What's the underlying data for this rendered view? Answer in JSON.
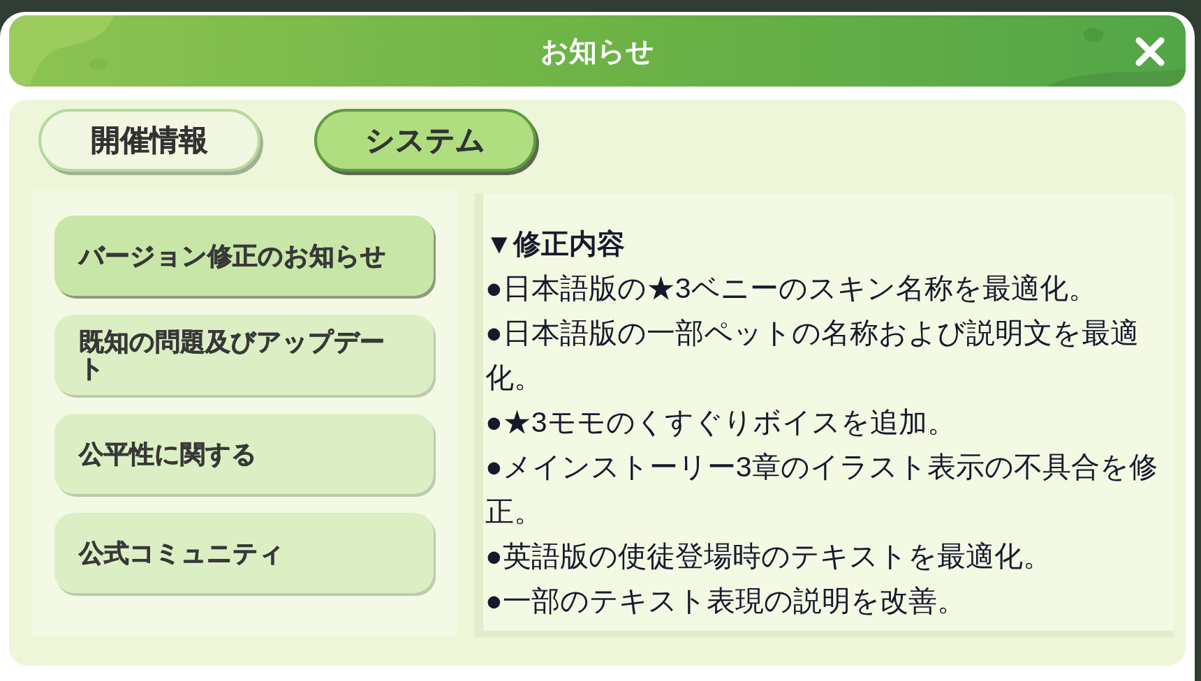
{
  "window": {
    "title": "お知らせ"
  },
  "tabs": [
    {
      "label": "開催情報",
      "selected": false
    },
    {
      "label": "システム",
      "selected": true
    }
  ],
  "sidebar": {
    "items": [
      {
        "label": "バージョン修正のお知らせ",
        "selected": true
      },
      {
        "label": "既知の問題及びアップデート",
        "selected": false
      },
      {
        "label": "公平性に関する",
        "selected": false
      },
      {
        "label": "公式コミュニティ",
        "selected": false
      }
    ]
  },
  "article": {
    "heading": "▼修正内容",
    "lines": [
      "●日本語版の★3ベニーのスキン名称を最適化。",
      "●日本語版の一部ペットの名称および説明文を最適化。",
      "●★3モモのくすぐりボイスを追加。",
      "●メインストーリー3章のイラスト表示の不具合を修正。",
      "●英語版の使徒登場時のテキストを最適化。",
      "●一部のテキスト表現の説明を改善。"
    ]
  }
}
